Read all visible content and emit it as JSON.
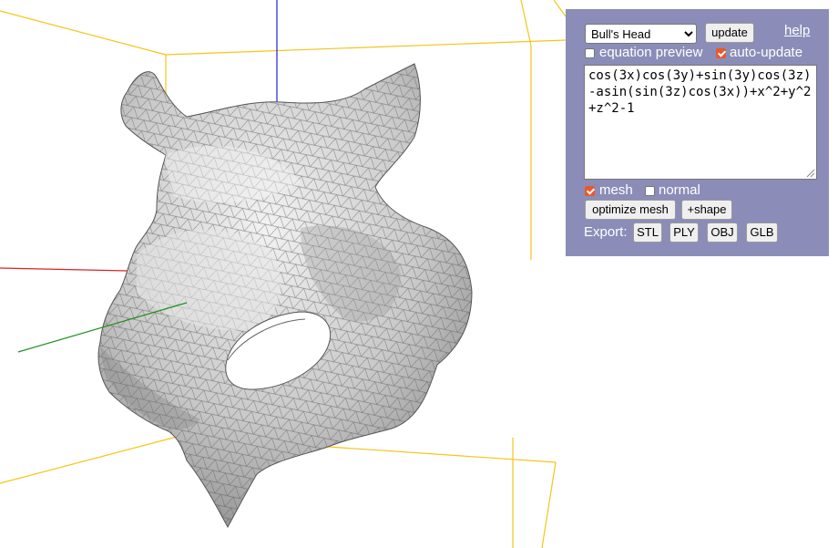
{
  "panel": {
    "preset_selected": "Bull's Head",
    "preset_options": [
      "Bull's Head"
    ],
    "update_label": "update",
    "help_label": "help",
    "equation_preview_label": "equation preview",
    "equation_preview_checked": false,
    "auto_update_label": "auto-update",
    "auto_update_checked": true,
    "equation": "cos(3x)cos(3y)+sin(3y)cos(3z)-asin(sin(3z)cos(3x))+x^2+y^2+z^2-1",
    "mesh_label": "mesh",
    "mesh_checked": true,
    "normal_label": "normal",
    "normal_checked": false,
    "optimize_label": "optimize mesh",
    "shape_label": "+shape",
    "export_label": "Export:",
    "export_buttons": [
      "STL",
      "PLY",
      "OBJ",
      "GLB"
    ]
  },
  "colors": {
    "panel_bg": "#8b8db8",
    "checkbox_accent": "#e8592c",
    "bounding_box": "#f5c518",
    "axis_x": "#e02020",
    "axis_y": "#1f8f1f",
    "axis_z": "#2020e0",
    "surface": "#c8c8c8",
    "mesh_lines": "#5a5a5a"
  }
}
